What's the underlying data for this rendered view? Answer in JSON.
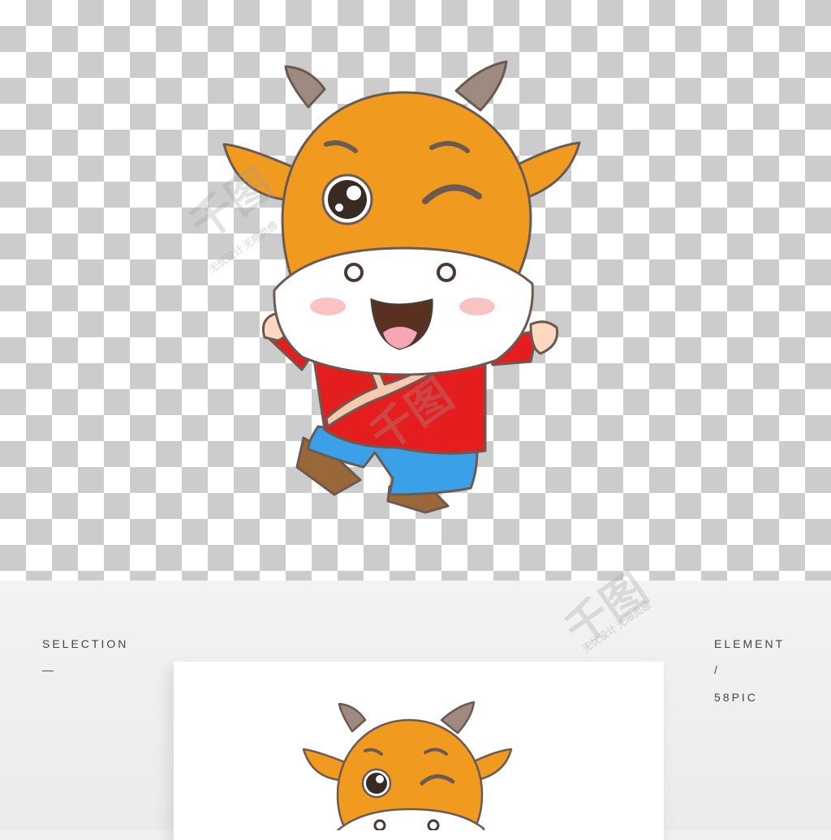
{
  "mockup": {
    "left_title": "SELECTION",
    "left_dash": "—",
    "right_title": "ELEMENT",
    "right_slash": "/",
    "right_site": "58PIC"
  },
  "watermark": {
    "brand": "千图",
    "tagline": "无忧设计 无限灵感"
  },
  "colors": {
    "head_orange": "#f09a20",
    "horn_gray": "#9e8a80",
    "shirt_red": "#e41e1e",
    "shorts_blue": "#3aa0e8",
    "boots_brown": "#9a6838",
    "outline": "#6b5a52"
  }
}
